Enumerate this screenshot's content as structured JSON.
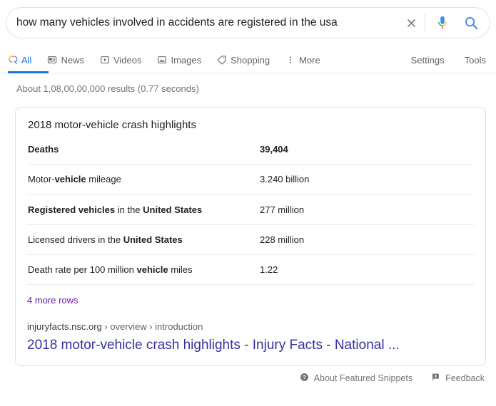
{
  "search": {
    "query": "how many vehicles involved in accidents are registered in the usa",
    "placeholder": "Search",
    "clear_icon": "close-icon",
    "mic_icon": "microphone-icon",
    "search_icon": "search-icon"
  },
  "nav": {
    "tabs": [
      {
        "label": "All",
        "icon": "search-icon",
        "active": true
      },
      {
        "label": "News",
        "icon": "news-icon",
        "active": false
      },
      {
        "label": "Videos",
        "icon": "video-icon",
        "active": false
      },
      {
        "label": "Images",
        "icon": "image-icon",
        "active": false
      },
      {
        "label": "Shopping",
        "icon": "tag-icon",
        "active": false
      },
      {
        "label": "More",
        "icon": "more-vertical-icon",
        "active": false
      }
    ],
    "right_links": [
      {
        "label": "Settings"
      },
      {
        "label": "Tools"
      }
    ],
    "accent_color": "#1a73e8"
  },
  "result_stats": "About 1,08,00,00,000 results (0.77 seconds)",
  "snippet": {
    "title": "2018 motor-vehicle crash highlights",
    "rows": [
      {
        "label_html": "Deaths",
        "value": "39,404",
        "header": true
      },
      {
        "label_html": "Motor-<b>vehicle</b> mileage",
        "value": "3.240 billion",
        "header": false
      },
      {
        "label_html": "<b>Registered vehicles</b> in the <b>United States</b>",
        "value": "277 million",
        "header": false
      },
      {
        "label_html": "Licensed drivers in the <b>United States</b>",
        "value": "228 million",
        "header": false
      },
      {
        "label_html": "Death rate per 100 million <b>vehicle</b> miles",
        "value": "1.22",
        "header": false
      }
    ],
    "more_rows_label": "4 more rows",
    "breadcrumb_domain": "injuryfacts.nsc.org",
    "breadcrumb_path": " › overview › introduction",
    "result_title": "2018 motor-vehicle crash highlights - Injury Facts - National ...",
    "link_color": "#3730a3",
    "visited_color": "#681da8"
  },
  "footer": {
    "about_label": "About Featured Snippets",
    "about_icon": "help-circle-icon",
    "feedback_label": "Feedback",
    "feedback_icon": "flag-icon"
  }
}
